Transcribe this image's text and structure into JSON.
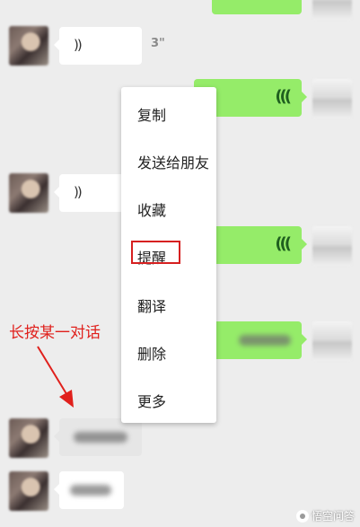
{
  "chat": {
    "voice_duration_1": "3\"",
    "voice_icon_left": "))",
    "voice_icon_right": "((("
  },
  "context_menu": {
    "items": [
      {
        "label": "复制"
      },
      {
        "label": "发送给朋友"
      },
      {
        "label": "收藏"
      },
      {
        "label": "提醒"
      },
      {
        "label": "翻译"
      },
      {
        "label": "删除"
      },
      {
        "label": "更多"
      }
    ],
    "highlighted_item": "提醒"
  },
  "annotation": {
    "text": "长按某一对话",
    "color": "#e0201c"
  },
  "watermark": {
    "text": "悟空问答"
  },
  "colors": {
    "background": "#ededed",
    "sent_bubble": "#95ec69",
    "received_bubble": "#ffffff",
    "highlight": "#d62020"
  },
  "icons": [
    "voice-icon",
    "arrow-icon",
    "wukong-logo-icon"
  ]
}
